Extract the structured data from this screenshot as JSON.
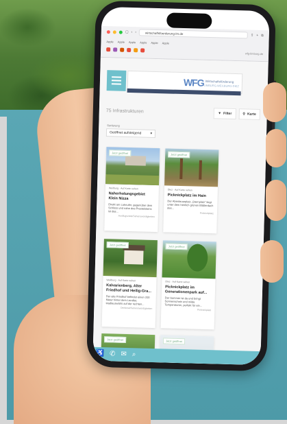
{
  "browser": {
    "address": "wirtschaftsfoerderung-lm.de",
    "sub_address": "wfg-limburg.de",
    "bookmarks": [
      "Apple",
      "Apple",
      "Apple",
      "Apple",
      "Apple",
      "Apple"
    ]
  },
  "site": {
    "logo_mark": "WFG",
    "logo_line1": "Wirtschaftsförderung",
    "logo_line2": "LIMBURG-WEILBURG-DIEZ"
  },
  "toolbar": {
    "result_count": "75 Infrastrukturen",
    "filter_label": "Filter",
    "map_label": "Karte"
  },
  "sort": {
    "label": "Sortierung",
    "value": "Geöffnet aufsteigend"
  },
  "cards": [
    {
      "badge": "Jetzt geöffnet",
      "meta": "Weilburg · Auf Karte sehen",
      "title": "Naherholungsgebiet Klein Nizza",
      "desc": "Direkt am Lahnufer, gegenüber dem Schloss und nahe des Prestelsteins ist das...",
      "tag": "Ausflugsziele/Sehenswürdigkeiten"
    },
    {
      "badge": "Jetzt geöffnet",
      "meta": "Diez · Auf Karte sehen",
      "title": "Picknickplatz im Hain",
      "desc": "Der Abenteuerplatz „Sternplatz“ liegt unter dem herrlich grünen Blätterdach des...",
      "tag": "Picknickplatz"
    },
    {
      "badge": "Jetzt geöffnet",
      "meta": "Weilburg · Auf Karte sehen",
      "title": "Kalvarienberg, Alter Friedhof und Heilig-Gra...",
      "desc": "Der alte Friedhof befindet einen 200 Meter hinter dem Landtor, stadtauswärts auf der rechten...",
      "tag": "Denkmal/Sehenswürdigkeiten"
    },
    {
      "badge": "Jetzt geöffnet",
      "meta": "Diez · Auf Karte sehen",
      "title": "Picknickplatz im Generationenpark auf...",
      "desc": "Der Sommer ist da und bringt Sonnenschein und milde Temperaturen, perfekt für ein...",
      "tag": "Picknickplatz"
    },
    {
      "badge": "Jetzt geöffnet",
      "meta": "",
      "title": "",
      "desc": "",
      "tag": ""
    },
    {
      "badge": "Jetzt geöffnet",
      "meta": "",
      "title": "",
      "desc": "",
      "tag": ""
    }
  ],
  "icons": {
    "menu": "hamburger-icon",
    "filter": "funnel-icon",
    "map": "map-pin-icon",
    "phone": "phone-icon",
    "mail": "mail-icon",
    "search": "search-icon",
    "accessibility": "accessibility-icon"
  },
  "colors": {
    "accent": "#6fc0cc",
    "badge_green": "#7bb08a",
    "logo_blue": "#5b86c4"
  }
}
